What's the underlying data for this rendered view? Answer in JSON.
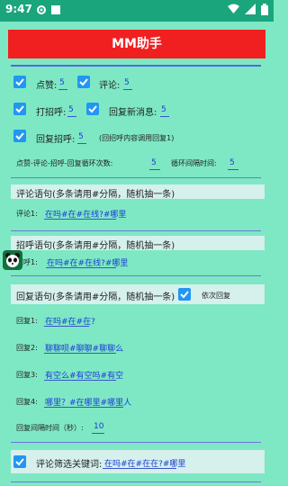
{
  "status": {
    "time": "9:47"
  },
  "title": "MM助手",
  "settings": {
    "like_label": "点赞:",
    "like_value": "5",
    "comment_label": "评论:",
    "comment_value": "5",
    "greet_label": "打招呼:",
    "greet_value": "5",
    "reply_new_label": "回复新消息:",
    "reply_new_value": "5",
    "reply_greet_label": "回复招呼:",
    "reply_greet_value": "5",
    "reply_greet_note": "(回招呼内容调用回复1)",
    "loop_label": "点赞-评论-招呼-回复循环次数:",
    "loop_value": "5",
    "interval_label": "循环间隔时间:",
    "interval_value": "5"
  },
  "comment_section": {
    "title": "评论语句(多条请用#分隔，随机抽一条)",
    "item_label": "评论1:",
    "item_value": "在吗#在#在线?#哪里"
  },
  "greet_section": {
    "title": "招呼语句(多条请用#分隔，随机抽一条)",
    "item_label": "招呼1:",
    "item_value": "在吗#在#在线?#哪里"
  },
  "reply_section": {
    "title": "回复语句(多条请用#分隔，随机抽一条)",
    "sequential_label": "依次回复",
    "items": [
      {
        "label": "回复1:",
        "value": "在吗#在#在?"
      },
      {
        "label": "回复2:",
        "value": "聊聊呗#聊聊#聊聊么"
      },
      {
        "label": "回复3:",
        "value": "有空么#有空吗#有空"
      },
      {
        "label": "回复4:",
        "value": "哪里？#在哪里#哪里人"
      }
    ],
    "interval_label": "回复间隔时间（秒）:",
    "interval_value": "10"
  },
  "filter": {
    "label": "评论筛选关键词:",
    "value": "在吗#在#在在?#哪里"
  },
  "colors": {
    "status_bar": "#1aa57c",
    "background": "#7ee8c4",
    "title_bar": "#f02020",
    "checkbox": "#2196f3",
    "link_text": "#1a3bd6"
  }
}
